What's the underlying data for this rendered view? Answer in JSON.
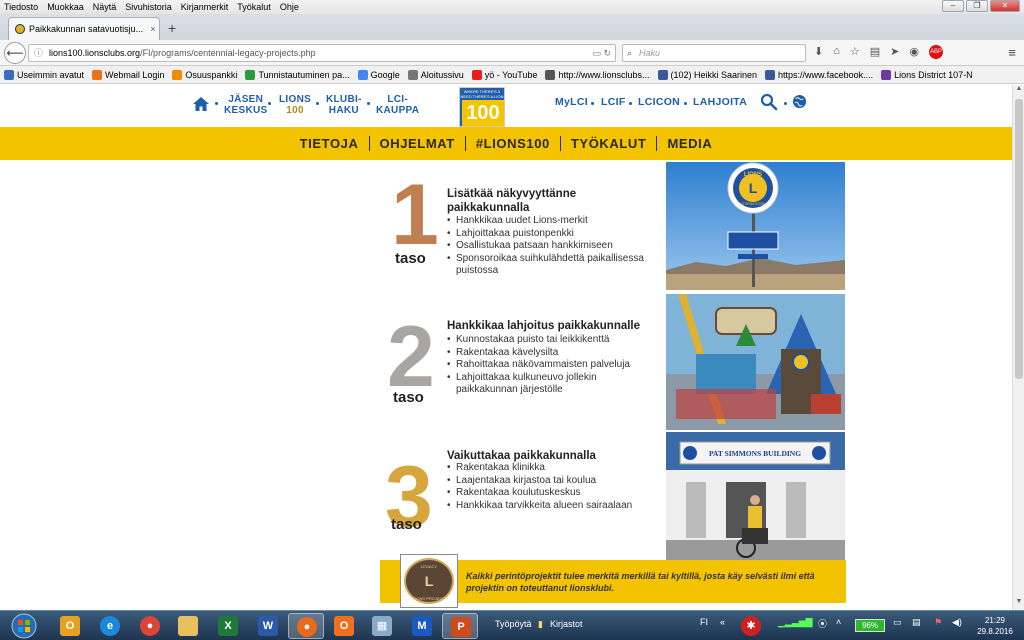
{
  "menubar": {
    "items": [
      "Tiedosto",
      "Muokkaa",
      "Näytä",
      "Sivuhistoria",
      "Kirjanmerkit",
      "Työkalut",
      "Ohje"
    ]
  },
  "tab": {
    "title": "Paikkakunnan satavuotisju...",
    "close": "×",
    "new": "+"
  },
  "url": {
    "host": "lions100.lionsclubs.org",
    "path": "/FI/programs/centennial-legacy-projects.php"
  },
  "search": {
    "placeholder": "Haku"
  },
  "bookmarks": [
    {
      "label": "Useimmin avatut",
      "color": "#3b6dbf"
    },
    {
      "label": "Webmail Login",
      "color": "#e8731a"
    },
    {
      "label": "Osuuspankki",
      "color": "#f08a00"
    },
    {
      "label": "Tunnistautuminen pa...",
      "color": "#2b9a3b"
    },
    {
      "label": "Google",
      "color": "#4285f4"
    },
    {
      "label": "Aloitussivu",
      "color": "#777777"
    },
    {
      "label": "yö - YouTube",
      "color": "#e62117"
    },
    {
      "label": "http://www.lionsclubs...",
      "color": "#555555"
    },
    {
      "label": "(102) Heikki Saarinen",
      "color": "#3b5998"
    },
    {
      "label": "https://www.facebook....",
      "color": "#3b5998"
    },
    {
      "label": "Lions District 107-N",
      "color": "#6a3aa0"
    }
  ],
  "site": {
    "nav_left": [
      {
        "l1": "JÄSEN",
        "l2": "KESKUS"
      },
      {
        "l1": "LIONS",
        "l2": "100"
      },
      {
        "l1": "KLUBI-",
        "l2": "HAKU"
      },
      {
        "l1": "LCI-",
        "l2": "KAUPPA"
      }
    ],
    "logo": {
      "tag": "WHERE THERE'S A NEED THERE'S A LION",
      "num": "100"
    },
    "nav_right": [
      "MyLCI",
      "LCIF",
      "LCICON",
      "LAHJOITA"
    ],
    "main_menu": [
      "TIETOJA",
      "OHJELMAT",
      "#LIONS100",
      "TYÖKALUT",
      "MEDIA"
    ]
  },
  "tiers": [
    {
      "num": "1",
      "color": "#c07f53",
      "label": "taso",
      "title": "Lisätkää näkyvyyttänne paikkakunnalla",
      "items": [
        "Hankkikaa uudet Lions-merkit",
        "Lahjoittakaa puistonpenkki",
        "Osallistukaa patsaan hankkimiseen",
        "Sponsoroikaa suihkulähdettä paikallisessa puistossa"
      ]
    },
    {
      "num": "2",
      "color": "#a9a5a2",
      "label": "taso",
      "title": "Hankkikaa lahjoitus paikkakunnalle",
      "items": [
        "Kunnostakaa puisto tai leikkikenttä",
        "Rakentakaa kävelysilta",
        "Rahoittakaa näkövammaisten palveluja",
        "Lahjoittakaa kulkuneuvo jollekin paikkakunnan järjestölle"
      ]
    },
    {
      "num": "3",
      "color": "#d6a63c",
      "label": "taso",
      "title": "Vaikuttakaa paikkakunnalla",
      "items": [
        "Rakentakaa klinikka",
        "Laajentakaa kirjastoa tai koulua",
        "Rakentakaa koulutuskeskus",
        "Hankkikaa tarvikkeita alueen sairaalaan"
      ]
    }
  ],
  "photos": {
    "sign_top": "LIONS",
    "sign_sub": "INTERNATIONAL",
    "building": "PAT SIMMONS BUILDING"
  },
  "footer": {
    "badge_top": "LEGACY",
    "badge_bottom": "LIONS PROJECT",
    "text": "Kaikki perintöprojektit tulee merkitä merkillä tai kyltillä, josta käy selvästi ilmi että projektin on toteuttanut lionsklubi."
  },
  "taskbar": {
    "desktop": "Työpöytä",
    "folder": "Kirjastot",
    "lang": "FI",
    "battery": "96%",
    "time": "21:29",
    "date": "29.8.2016"
  }
}
